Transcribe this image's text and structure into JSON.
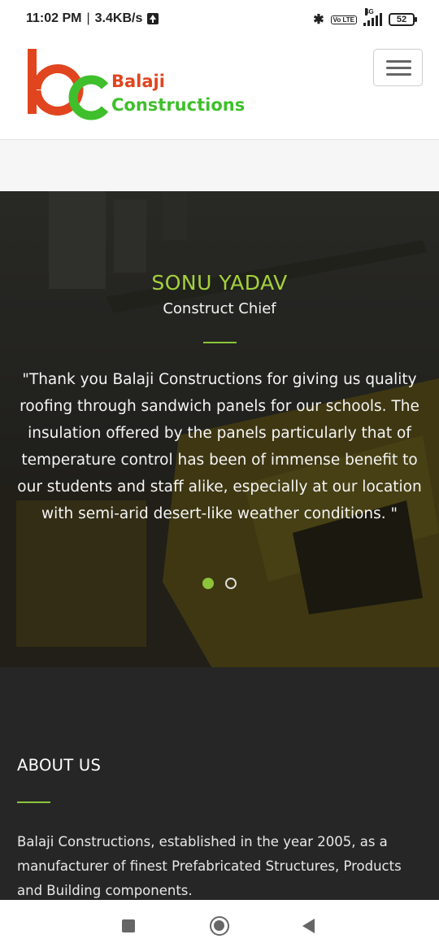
{
  "status_bar": {
    "time": "11:02 PM",
    "separator": "|",
    "speed": "3.4KB/s",
    "network_label": "4G",
    "volte_label": "Vo LTE",
    "battery": "52"
  },
  "header": {
    "brand_line1": "Balaji",
    "brand_line2": "Constructions",
    "logo_colors": {
      "b": "#e0451f",
      "c": "#3fbf2c"
    }
  },
  "testimonial": {
    "name": "SONU YADAV",
    "role": "Construct Chief",
    "quote": "\"Thank you Balaji Constructions for giving us quality roofing through sandwich panels for our schools. The insulation offered by the panels particularly that of temperature control has been of immense benefit to our students and staff alike, especially at our location with semi-arid desert-like weather conditions. \"",
    "slides_total": 2,
    "active_slide": 1,
    "accent_color": "#a4d13c"
  },
  "about": {
    "title": "ABOUT US",
    "text": "Balaji Constructions, established in the year 2005, as a manufacturer of finest Prefabricated Structures, Products and Building components."
  },
  "navbar": {
    "icons": [
      "recent-apps-icon",
      "home-icon",
      "back-icon"
    ]
  }
}
